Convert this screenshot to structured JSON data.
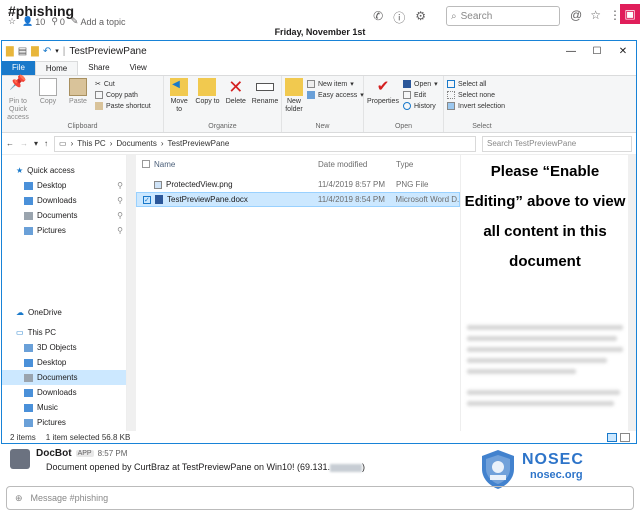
{
  "slack": {
    "channel": "#phishing",
    "members": "10",
    "pins": "0",
    "add_topic": "Add a topic",
    "search_placeholder": "Search",
    "date_divider": "Friday, November 1st"
  },
  "explorer": {
    "title": "TestPreviewPane",
    "tabs": [
      "File",
      "Home",
      "Share",
      "View"
    ],
    "ribbon": {
      "clipboard": {
        "label": "Clipboard",
        "pin": "Pin to Quick access",
        "copy": "Copy",
        "paste": "Paste",
        "cut": "Cut",
        "copy_path": "Copy path",
        "paste_shortcut": "Paste shortcut"
      },
      "organize": {
        "label": "Organize",
        "move_to": "Move to",
        "copy_to": "Copy to",
        "delete": "Delete",
        "rename": "Rename"
      },
      "new": {
        "label": "New",
        "new_folder": "New folder",
        "new_item": "New item",
        "easy_access": "Easy access"
      },
      "open": {
        "label": "Open",
        "properties": "Properties",
        "open": "Open",
        "edit": "Edit",
        "history": "History"
      },
      "select": {
        "label": "Select",
        "select_all": "Select all",
        "select_none": "Select none",
        "invert": "Invert selection"
      }
    },
    "address": {
      "this_pc": "This PC",
      "documents": "Documents",
      "folder": "TestPreviewPane",
      "search_placeholder": "Search TestPreviewPane"
    },
    "nav": {
      "quick_access": "Quick access",
      "quick_items": [
        "Desktop",
        "Downloads",
        "Documents",
        "Pictures"
      ],
      "onedrive": "OneDrive",
      "this_pc": "This PC",
      "pc_items": [
        "3D Objects",
        "Desktop",
        "Documents",
        "Downloads",
        "Music",
        "Pictures"
      ]
    },
    "columns": {
      "name": "Name",
      "date": "Date modified",
      "type": "Type"
    },
    "files": [
      {
        "name": "ProtectedView.png",
        "date": "11/4/2019 8:57 PM",
        "type": "PNG File"
      },
      {
        "name": "TestPreviewPane.docx",
        "date": "11/4/2019 8:54 PM",
        "type": "Microsoft Word D..."
      }
    ],
    "preview_message": "Please “Enable Editing” above to view all content in this document",
    "status": {
      "items": "2 items",
      "selected": "1 item selected  56.8 KB"
    }
  },
  "message": {
    "author": "DocBot",
    "badge": "APP",
    "time": "8:57 PM",
    "text": "Document opened by CurtBraz at TestPreviewPane on Win10! (69.131.",
    "closing": ")"
  },
  "composer": {
    "placeholder": "Message #phishing"
  },
  "watermark": {
    "title": "NOSEC",
    "url": "nosec.org"
  },
  "colors": {
    "file_tab": "#1979ca",
    "selection": "#cce8ff",
    "link": "#1264a3",
    "brand": "#2d74c9"
  }
}
